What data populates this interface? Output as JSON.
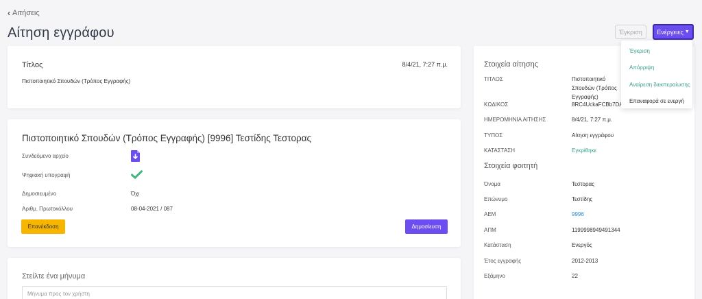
{
  "nav": {
    "back_label": "Αιτήσεις"
  },
  "page": {
    "title": "Αίτηση εγγράφου"
  },
  "header_actions": {
    "approve_label": "Έγκριση",
    "actions_label": "Ενέργειες",
    "menu": [
      "Έγκριση",
      "Απόρριψη",
      "Αναίρεση διεκπεραίωσης",
      "Επαναφορά σε ενεργή"
    ]
  },
  "title_card": {
    "label": "Τίτλος",
    "date": "8/4/21, 7:27 π.μ.",
    "value": "Πιστοποιητικό Σπουδών (Τρόπος Εγγραφής)"
  },
  "document_card": {
    "heading": "Πιστοποιητικό Σπουδών (Τρόπος Εγγραφής) [9996] Τεστίδης Τεστορας",
    "fields": {
      "attached_label": "Συνδεόμενο αρχείο",
      "signature_label": "Ψηφιακή υπογραφή",
      "published_label": "Δημοσιευμένο",
      "published_value": "Όχι",
      "protocol_label": "Αριθμ. Πρωτοκόλλου",
      "protocol_value": "08-04-2021 / 087"
    },
    "reissue_label": "Επανέκδοση",
    "publish_label": "Δημοσίευση"
  },
  "message_card": {
    "heading": "Στείλτε ένα μήνυμα",
    "placeholder": "Μήνυμα προς τον χρήστη"
  },
  "details": {
    "request_heading": "Στοιχεία αίτησης",
    "request": {
      "title_label": "ΤΙΤΛΟΣ",
      "title_value": "Πιστοποιητικό Σπουδών (Τρόπος Εγγραφής)",
      "code_label": "ΚΩΔΙΚΟΣ",
      "code_value": "8RC4UckaFCBb7DA",
      "date_label": "ΗΜΕΡΟΜΗΝΙΑ ΑΙΤΗΣΗΣ",
      "date_value": "8/4/21, 7:27 π.μ.",
      "type_label": "ΤΥΠΟΣ",
      "type_value": "Αίτηση εγγράφου",
      "status_label": "ΚΑΤΑΣΤΑΣΗ",
      "status_value": "Εγκρίθηκε"
    },
    "student_heading": "Στοιχεία φοιτητή",
    "student": {
      "name_label": "Όνομα",
      "name_value": "Τεστορας",
      "surname_label": "Επώνυμο",
      "surname_value": "Τεστίδης",
      "aem_label": "ΑΕΜ",
      "aem_value": "9996",
      "apm_label": "ΑΠΜ",
      "apm_value": "1199998949491344",
      "state_label": "Κατάσταση",
      "state_value": "Ενεργός",
      "year_label": "Έτος εγγραφής",
      "year_value": "2012-2013",
      "semester_label": "Εξάμηνο",
      "semester_value": "22"
    }
  },
  "colors": {
    "primary": "#6c4df0",
    "warning": "#f8b500",
    "success": "#3b9f8c",
    "link": "#2a8ad4"
  }
}
